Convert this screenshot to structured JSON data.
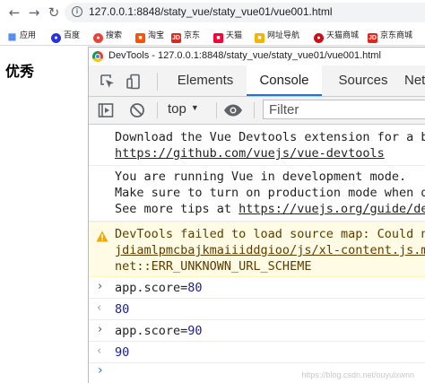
{
  "browser": {
    "url": "127.0.0.1:8848/staty_vue/staty_vue01/vue001.html",
    "bookmarks": [
      {
        "label": "应用",
        "icon": "apps-grid-icon",
        "color": "#4285f4"
      },
      {
        "label": "百度",
        "icon": "baidu-icon",
        "color": "#2932e1"
      },
      {
        "label": "搜索",
        "icon": "search-engine-icon",
        "color": "#ea4335"
      },
      {
        "label": "淘宝",
        "icon": "taobao-icon",
        "color": "#ff5000"
      },
      {
        "label": "京东",
        "icon": "jd-icon",
        "color": "#e1251b"
      },
      {
        "label": "天猫",
        "icon": "tmall-icon",
        "color": "#ff0036"
      },
      {
        "label": "网址导航",
        "icon": "nav-icon",
        "color": "#f4b400"
      },
      {
        "label": "天猫商城",
        "icon": "tmall-mall-icon",
        "color": "#d10c19"
      },
      {
        "label": "京东商城",
        "icon": "jd-mall-icon",
        "color": "#e1251b"
      }
    ]
  },
  "page": {
    "heading": "优秀"
  },
  "devtools": {
    "title": "DevTools - 127.0.0.1:8848/staty_vue/staty_vue01/vue001.html",
    "tabs": [
      "Elements",
      "Console",
      "Sources",
      "Network"
    ],
    "active_tab": "Console",
    "context": "top",
    "filter_placeholder": "Filter",
    "accent": "#1a73e8",
    "messages": {
      "devtools_ext": [
        "Download the Vue Devtools extension for a better development experience:",
        "https://github.com/vuejs/vue-devtools"
      ],
      "dev_mode": [
        "You are running Vue in development mode.",
        "Make sure to turn on production mode when deploying for production.",
        "See more tips at ",
        "https://vuejs.org/guide/deployment.html"
      ],
      "warning": [
        "DevTools failed to load source map: Could not load content for chrome-extension://ibefaeehajgcpooopoegkifhgecigeeg/",
        "jdiamlpmcbajkmaiiiddgioo/js/xl-content.js.map",
        "net::ERR_UNKNOWN_URL_SCHEME"
      ],
      "warning_color": "#fffbe5",
      "commands": [
        {
          "input_key": "app.score=",
          "input_value": "80",
          "result": "80"
        },
        {
          "input_key": "app.score=",
          "input_value": "90",
          "result": "90"
        }
      ]
    },
    "watermark": "https://blog.csdn.net/ouyulxwnn"
  }
}
